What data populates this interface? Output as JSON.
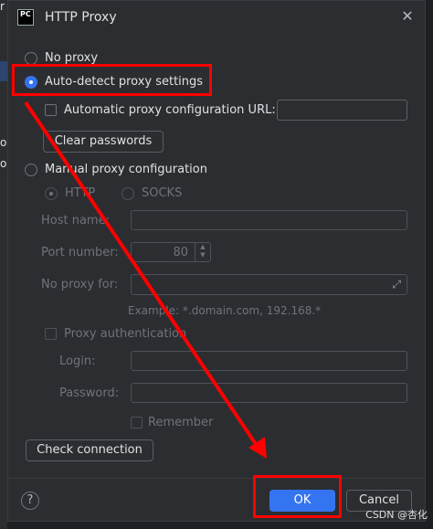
{
  "background": {
    "fragments": [
      "r",
      "oy",
      "or"
    ]
  },
  "dialog": {
    "app_icon_text": "PC",
    "title": "HTTP Proxy",
    "close_glyph": "✕"
  },
  "options": {
    "no_proxy": "No proxy",
    "auto_detect": "Auto-detect proxy settings",
    "auto_config_url": "Automatic proxy configuration URL:",
    "clear_passwords": "Clear passwords",
    "manual": "Manual proxy configuration",
    "http": "HTTP",
    "socks": "SOCKS",
    "host_name": "Host name:",
    "port_number": "Port number:",
    "port_value": "80",
    "no_proxy_for": "No proxy for:",
    "example": "Example: *.domain.com, 192.168.*",
    "proxy_auth": "Proxy authentication",
    "login": "Login:",
    "password": "Password:",
    "remember": "Remember",
    "check_connection": "Check connection"
  },
  "footer": {
    "help": "?",
    "ok": "OK",
    "cancel": "Cancel"
  },
  "annotation": {
    "color": "#ff0000"
  },
  "watermark": "CSDN @杏化"
}
